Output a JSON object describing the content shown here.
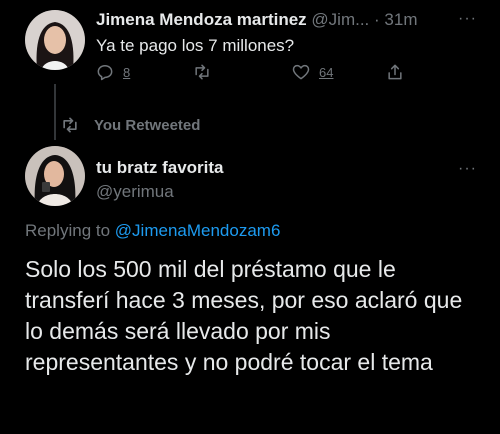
{
  "tweet1": {
    "display_name": "Jimena Mendoza martinez",
    "handle": "@Jim...",
    "separator": "·",
    "time": "31m",
    "text": "Ya te pago los 7 millones?",
    "reply_count": "8",
    "like_count": "64",
    "more": "···"
  },
  "retweet_banner": {
    "label": "You Retweeted"
  },
  "tweet2": {
    "display_name": "tu bratz favorita",
    "handle": "@yerimua",
    "more": "···",
    "replying_prefix": "Replying to",
    "replying_mention": "@JimenaMendozam6",
    "text": "Solo los 500 mil del préstamo que le transferí hace 3 meses, por eso aclaró que lo demás será llevado por mis representantes y no podré tocar el tema"
  },
  "colors": {
    "background": "#000000",
    "primary_text": "#e7e9ea",
    "secondary_text": "#71767b",
    "link": "#1d9bf0"
  }
}
